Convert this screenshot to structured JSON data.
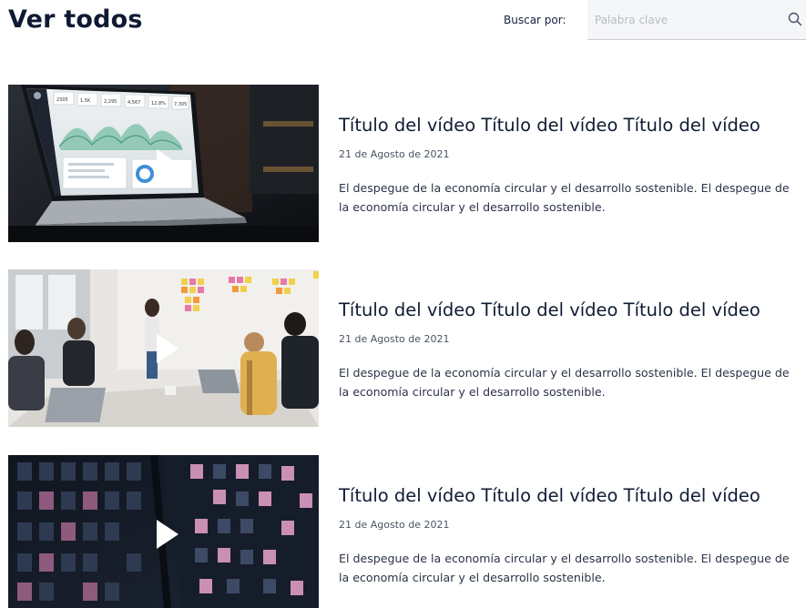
{
  "header": {
    "title": "Ver todos",
    "search_label": "Buscar por:",
    "search_placeholder": "Palabra clave",
    "search_value": ""
  },
  "videos": [
    {
      "title": "Título del vídeo Título del vídeo Título del vídeo",
      "date": "21 de Agosto de 2021",
      "description": "El despegue de la economía circular y el desarrollo sostenible. El despegue de la economía circular y el desarrollo sostenible.",
      "thumb_dashboard_stats": [
        "2305",
        "1.5K",
        "2,295",
        "4,567",
        "12.8%",
        "7,305"
      ]
    },
    {
      "title": "Título del vídeo Título del vídeo Título del vídeo",
      "date": "21 de Agosto de 2021",
      "description": "El despegue de la economía circular y el desarrollo sostenible. El despegue de la economía circular y el desarrollo sostenible."
    },
    {
      "title": "Título del vídeo Título del vídeo Título del vídeo",
      "date": "21 de Agosto de 2021",
      "description": "El despegue de la economía circular y el desarrollo sostenible. El despegue de la economía circular y el desarrollo sostenible."
    }
  ],
  "colors": {
    "text_dark": "#0f1b33",
    "search_bg": "#f5f6f8",
    "placeholder": "#b6bcc6"
  },
  "icons": {
    "search": "search-icon",
    "play": "play-icon"
  }
}
